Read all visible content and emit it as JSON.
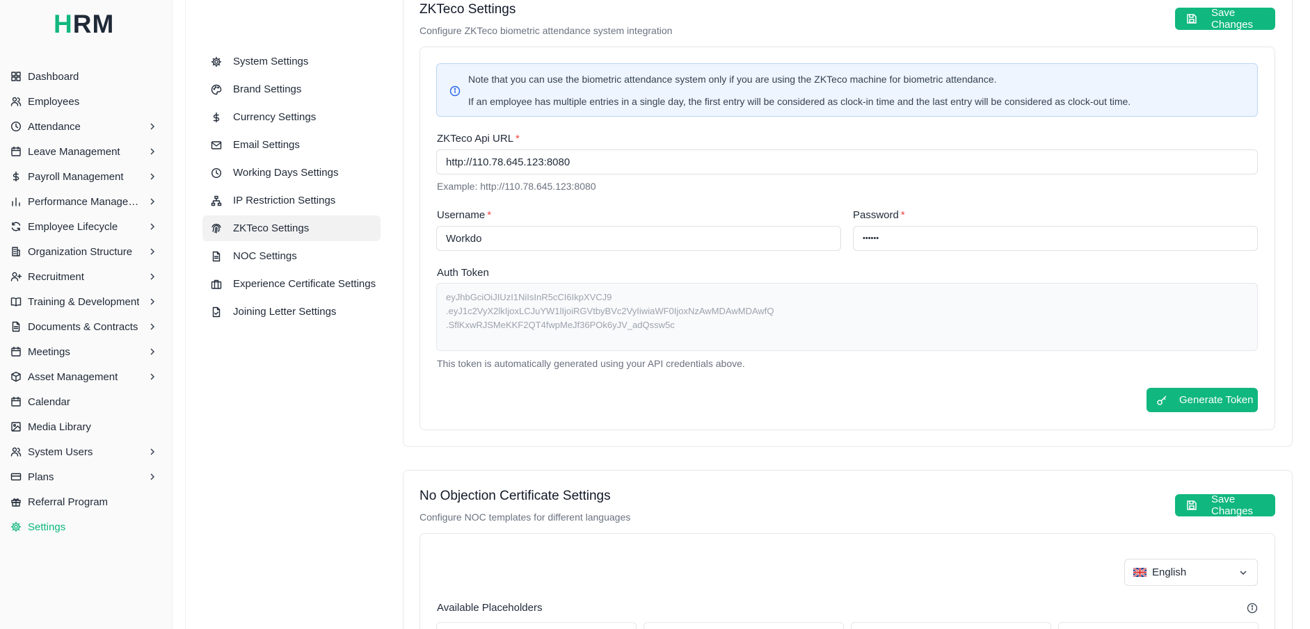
{
  "brand": {
    "logo_left": "H",
    "logo_rest": "RM"
  },
  "sidebar": {
    "items": [
      {
        "label": "Dashboard",
        "icon": "dashboard-icon",
        "chevron": false
      },
      {
        "label": "Employees",
        "icon": "users-icon",
        "chevron": false
      },
      {
        "label": "Attendance",
        "icon": "clock-icon",
        "chevron": true
      },
      {
        "label": "Leave Management",
        "icon": "calendar-icon",
        "chevron": true
      },
      {
        "label": "Payroll Management",
        "icon": "dollar-icon",
        "chevron": true
      },
      {
        "label": "Performance Managem...",
        "icon": "bar-chart-icon",
        "chevron": true
      },
      {
        "label": "Employee Lifecycle",
        "icon": "refresh-icon",
        "chevron": true
      },
      {
        "label": "Organization Structure",
        "icon": "building-icon",
        "chevron": true
      },
      {
        "label": "Recruitment",
        "icon": "user-plus-icon",
        "chevron": true
      },
      {
        "label": "Training & Development",
        "icon": "book-icon",
        "chevron": true
      },
      {
        "label": "Documents & Contracts",
        "icon": "document-icon",
        "chevron": true
      },
      {
        "label": "Meetings",
        "icon": "calendar-icon",
        "chevron": true
      },
      {
        "label": "Asset Management",
        "icon": "box-icon",
        "chevron": true
      },
      {
        "label": "Calendar",
        "icon": "calendar-icon",
        "chevron": false
      },
      {
        "label": "Media Library",
        "icon": "image-icon",
        "chevron": false
      },
      {
        "label": "System Users",
        "icon": "users-icon",
        "chevron": true
      },
      {
        "label": "Plans",
        "icon": "credit-card-icon",
        "chevron": true
      },
      {
        "label": "Referral Program",
        "icon": "gift-icon",
        "chevron": false
      },
      {
        "label": "Settings",
        "icon": "gear-icon",
        "chevron": false,
        "active": true
      }
    ]
  },
  "settings_menu": {
    "items": [
      {
        "label": "System Settings",
        "icon": "gear-icon"
      },
      {
        "label": "Brand Settings",
        "icon": "palette-icon"
      },
      {
        "label": "Currency Settings",
        "icon": "dollar-icon"
      },
      {
        "label": "Email Settings",
        "icon": "mail-icon"
      },
      {
        "label": "Working Days Settings",
        "icon": "clock-icon"
      },
      {
        "label": "IP Restriction Settings",
        "icon": "network-icon"
      },
      {
        "label": "ZKTeco Settings",
        "icon": "fingerprint-icon",
        "active": true
      },
      {
        "label": "NOC Settings",
        "icon": "document-icon"
      },
      {
        "label": "Experience Certificate Settings",
        "icon": "briefcase-icon"
      },
      {
        "label": "Joining Letter Settings",
        "icon": "file-check-icon"
      }
    ]
  },
  "zkteco": {
    "title": "ZKTeco Settings",
    "subtitle": "Configure ZKTeco biometric attendance system integration",
    "save_label": "Save Changes",
    "info_line1": "Note that you can use the biometric attendance system only if you are using the ZKTeco machine for biometric attendance.",
    "info_line2": "If an employee has multiple entries in a single day, the first entry will be considered as clock-in time and the last entry will be considered as clock-out time.",
    "api_url_label": "ZKTeco Api URL",
    "api_url_value": "http://110.78.645.123:8080",
    "api_url_hint": "Example: http://110.78.645.123:8080",
    "username_label": "Username",
    "username_value": "Workdo",
    "password_label": "Password",
    "password_value": "••••••",
    "auth_token_label": "Auth Token",
    "auth_token_lines": [
      "eyJhbGciOiJIUzI1NiIsInR5cCI6IkpXVCJ9",
      ".eyJ1c2VyX2lkIjoxLCJuYW1lIjoiRGVtbyBVc2VyIiwiaWF0IjoxNzAwMDAwMDAwfQ",
      ".SflKxwRJSMeKKF2QT4fwpMeJf36POk6yJV_adQssw5c"
    ],
    "auth_token_hint": "This token is automatically generated using your API credentials above.",
    "generate_label": "Generate Token",
    "required_mark": "*"
  },
  "noc": {
    "title": "No Objection Certificate Settings",
    "subtitle": "Configure NOC templates for different languages",
    "save_label": "Save Changes",
    "language_value": "English",
    "placeholders_label": "Available Placeholders"
  },
  "colors": {
    "accent": "#10b77f",
    "info_bg": "#eef5fe",
    "required": "#ef4444"
  }
}
